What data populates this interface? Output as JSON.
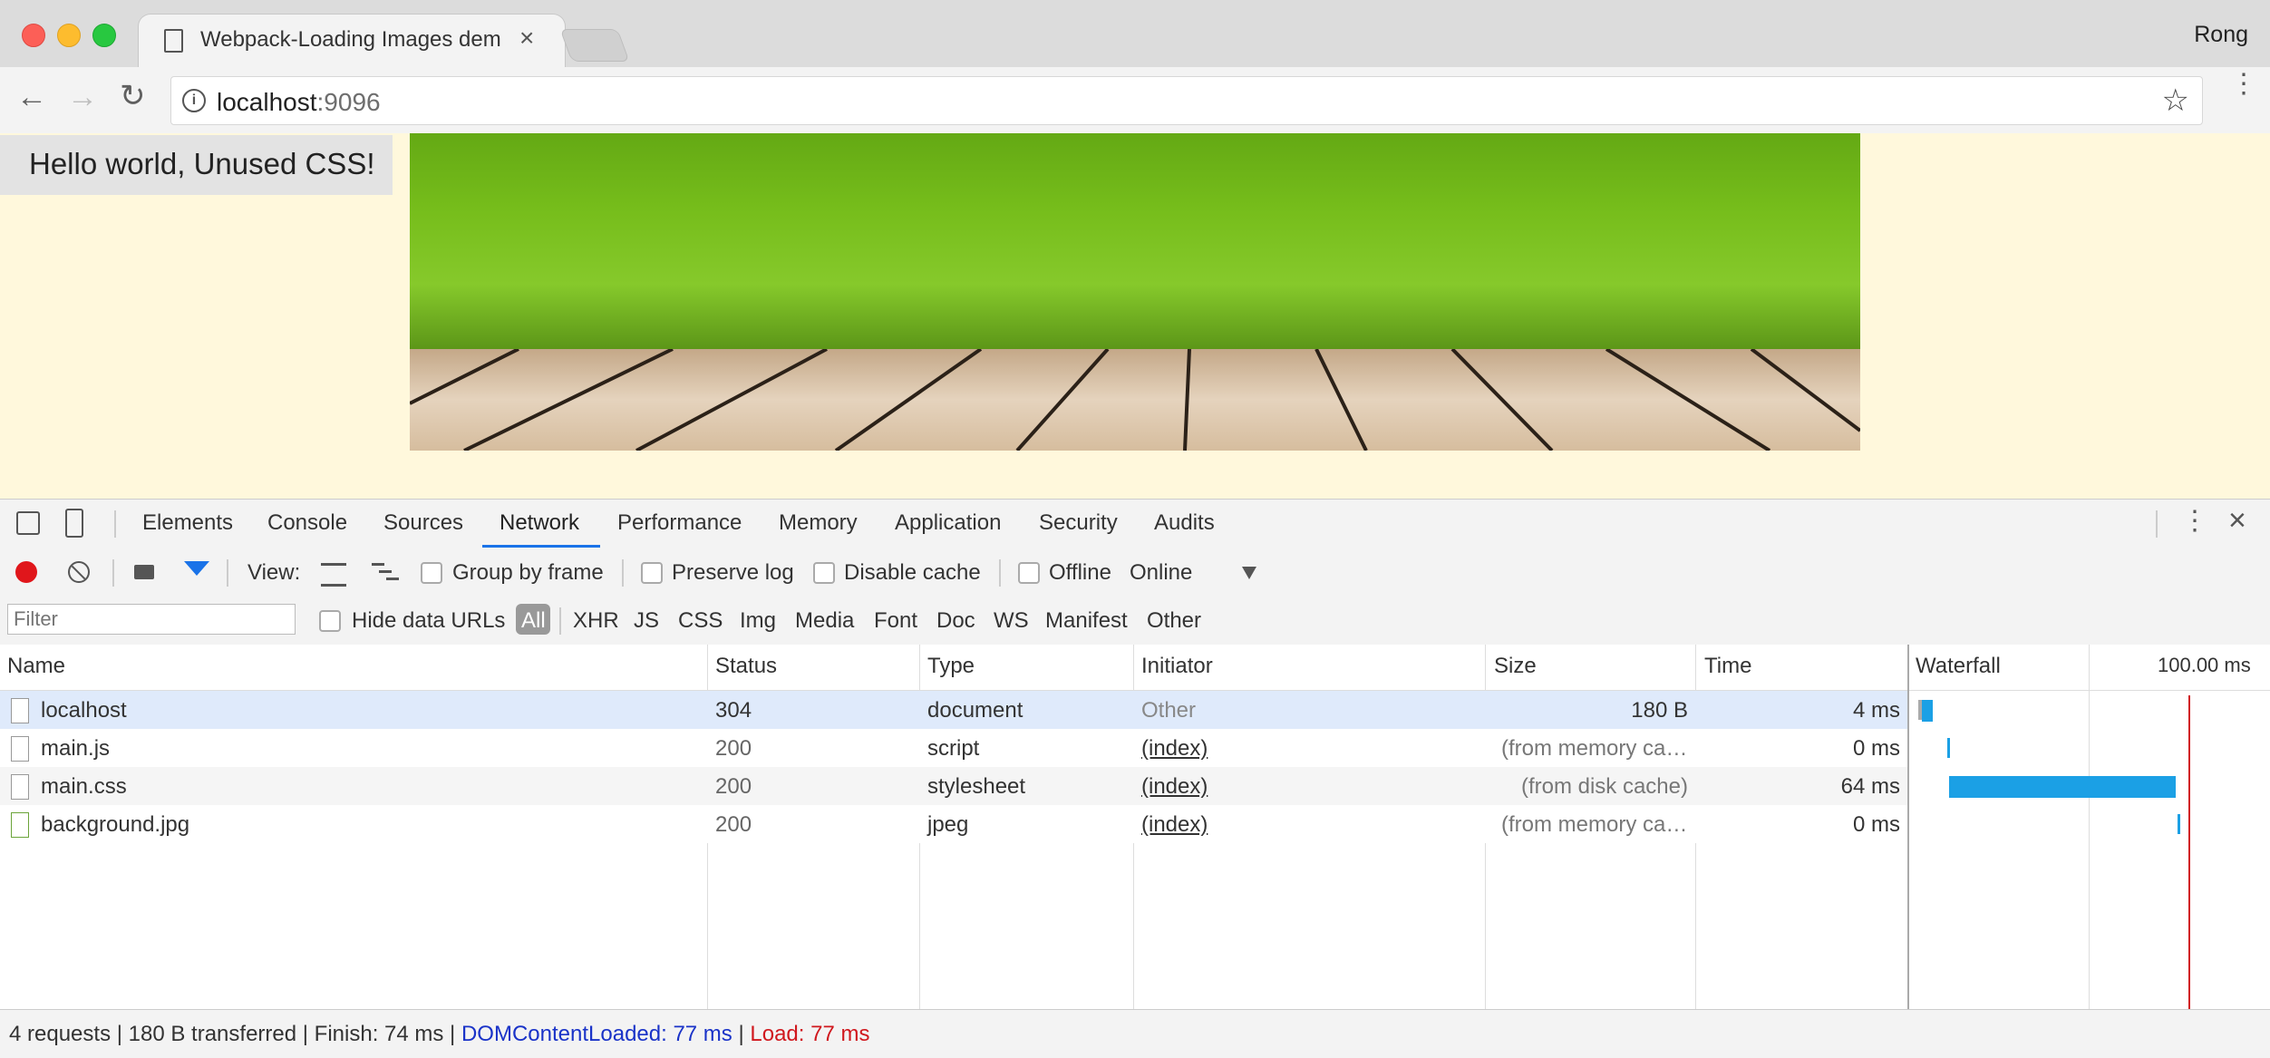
{
  "browser": {
    "tab_title": "Webpack-Loading Images dem",
    "profile_name": "Rong",
    "url_host": "localhost",
    "url_port": ":9096"
  },
  "page": {
    "hello_text": "Hello world, Unused CSS!"
  },
  "devtools": {
    "tabs": [
      "Elements",
      "Console",
      "Sources",
      "Network",
      "Performance",
      "Memory",
      "Application",
      "Security",
      "Audits"
    ],
    "active_tab": "Network",
    "toolbar": {
      "view_label": "View:",
      "group_by_frame": "Group by frame",
      "preserve_log": "Preserve log",
      "disable_cache": "Disable cache",
      "offline": "Offline",
      "throttle": "Online"
    },
    "filter": {
      "placeholder": "Filter",
      "hide_data_urls": "Hide data URLs",
      "types": [
        "All",
        "XHR",
        "JS",
        "CSS",
        "Img",
        "Media",
        "Font",
        "Doc",
        "WS",
        "Manifest",
        "Other"
      ],
      "active_type": "All"
    },
    "table": {
      "headers": {
        "name": "Name",
        "status": "Status",
        "type": "Type",
        "initiator": "Initiator",
        "size": "Size",
        "time": "Time",
        "waterfall": "Waterfall",
        "waterfall_scale": "100.00 ms"
      },
      "rows": [
        {
          "name": "localhost",
          "status": "304",
          "type": "document",
          "initiator": "Other",
          "size": "180 B",
          "time": "4 ms"
        },
        {
          "name": "main.js",
          "status": "200",
          "type": "script",
          "initiator": "(index)",
          "size": "(from memory ca…",
          "time": "0 ms"
        },
        {
          "name": "main.css",
          "status": "200",
          "type": "stylesheet",
          "initiator": "(index)",
          "size": "(from disk cache)",
          "time": "64 ms"
        },
        {
          "name": "background.jpg",
          "status": "200",
          "type": "jpeg",
          "initiator": "(index)",
          "size": "(from memory ca…",
          "time": "0 ms"
        }
      ]
    },
    "summary": {
      "requests": "4 requests",
      "transferred": "180 B transferred",
      "finish": "Finish: 74 ms",
      "dom_loaded": "DOMContentLoaded: 77 ms",
      "load": "Load: 77 ms"
    }
  },
  "colors": {
    "accent": "#1a73e8",
    "waterfall_bar": "#1ba0e5",
    "record": "#e0161b",
    "dom_loaded": "#1a33c8",
    "load": "#d0181e",
    "page_bg": "#fff8dc"
  }
}
